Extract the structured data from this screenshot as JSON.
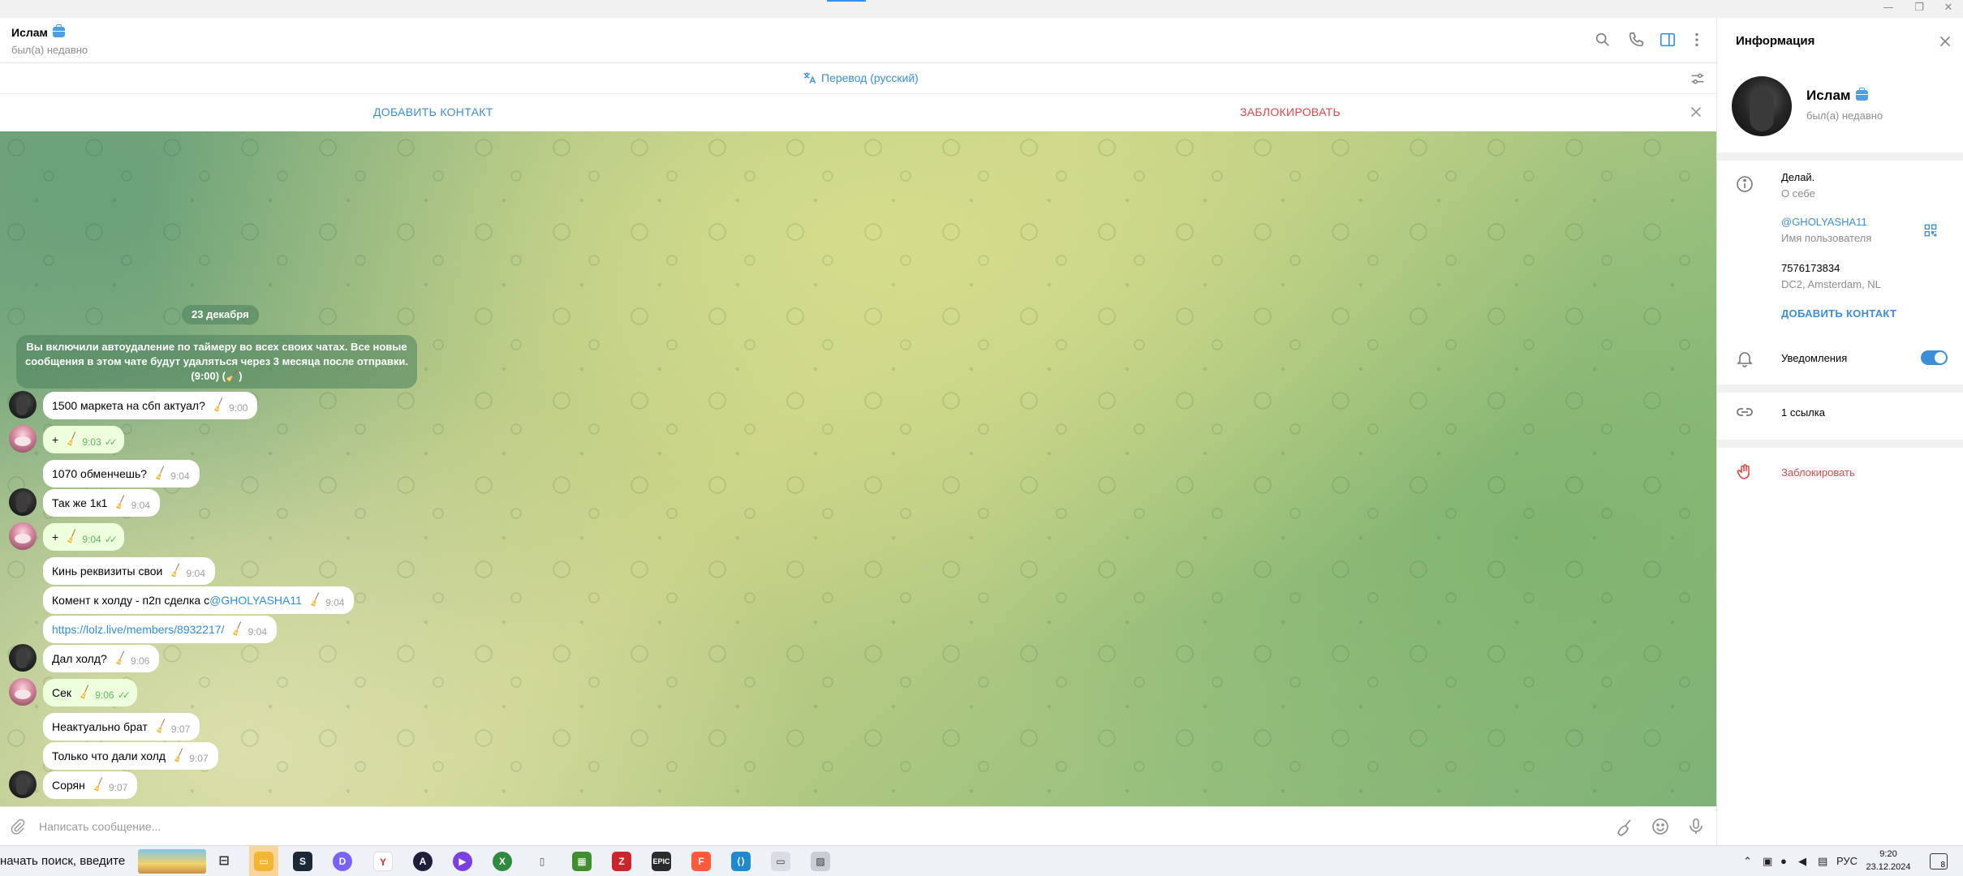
{
  "chat": {
    "name": "Ислам",
    "status": "был(а) недавно",
    "translate_label": "Перевод (русский)",
    "add_contact_label": "ДОБАВИТЬ КОНТАКТ",
    "block_label": "ЗАБЛОКИРОВАТЬ",
    "date_label": "23 декабря",
    "system_message": "Вы включили автоудаление по таймеру во всех своих чатах. Все новые сообщения в этом чате будут удаляться через 3 месяца после отправки.",
    "system_message_suffix": "(9:00) (🧹)",
    "messages": [
      {
        "text": "1500 маркета на сбп актуал?",
        "time": "9:00",
        "direction": "in"
      },
      {
        "text": "+",
        "time": "9:03",
        "direction": "out"
      },
      {
        "text": "1070 обменчешь?",
        "time": "9:04",
        "direction": "in"
      },
      {
        "text": "Так же 1к1",
        "time": "9:04",
        "direction": "in"
      },
      {
        "text": "+",
        "time": "9:04",
        "direction": "out"
      },
      {
        "text": "Кинь реквизиты свои",
        "time": "9:04",
        "direction": "in"
      },
      {
        "text": "Комент к холду - п2п сделка с ",
        "mention": "@GHOLYASHA11",
        "time": "9:04",
        "direction": "in"
      },
      {
        "text": "https://lolz.live/members/8932217/",
        "time": "9:04",
        "direction": "in"
      },
      {
        "text": "Дал холд?",
        "time": "9:06",
        "direction": "in"
      },
      {
        "text": "Сек",
        "time": "9:06",
        "direction": "out"
      },
      {
        "text": "Неактуально брат",
        "time": "9:07",
        "direction": "in"
      },
      {
        "text": "Только что дали холд",
        "time": "9:07",
        "direction": "in"
      },
      {
        "text": "Сорян",
        "time": "9:07",
        "direction": "in"
      }
    ],
    "composer_placeholder": "Написать сообщение..."
  },
  "info": {
    "title": "Информация",
    "name": "Ислам",
    "status": "был(а) недавно",
    "bio": "Делай.",
    "bio_label": "О себе",
    "username": "@GHOLYASHA11",
    "username_label": "Имя пользователя",
    "id": "7576173834",
    "dc": "DC2, Amsterdam, NL",
    "add_contact": "ДОБАВИТЬ КОНТАКТ",
    "notifications_label": "Уведомления",
    "notifications_on": true,
    "links_label": "1 ссылка",
    "block_label": "Заблокировать"
  },
  "taskbar": {
    "search_text": "начать поиск, введите",
    "lang": "РУС",
    "time": "9:20",
    "date": "23.12.2024",
    "notif_count": "8"
  },
  "colors": {
    "accent": "#3a8fd8",
    "danger": "#e04747",
    "outgoing_bubble": "#eeffde",
    "read_check": "#5db75d"
  }
}
